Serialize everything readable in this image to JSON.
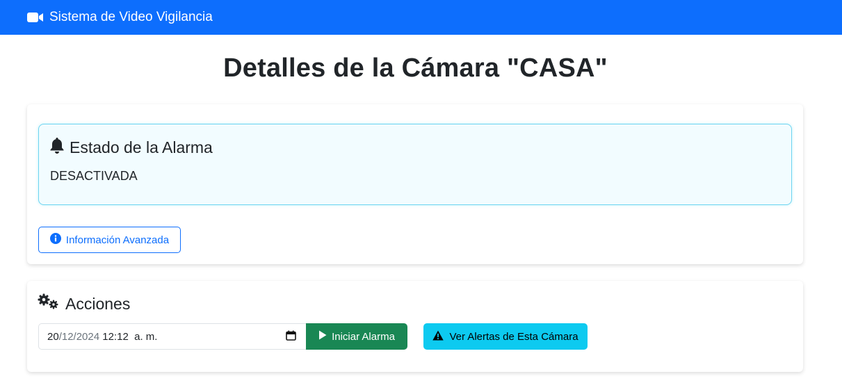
{
  "navbar": {
    "brand_label": "Sistema de Video Vigilancia",
    "brand_icon": "video-camera-icon",
    "background": "#0d6efd"
  },
  "page": {
    "title": "Detalles de la Cámara \"CASA\""
  },
  "alarm": {
    "heading": "Estado de la Alarma",
    "heading_icon": "bell-icon",
    "status": "DESACTIVADA",
    "advanced_button_label": "Información Avanzada",
    "advanced_button_icon": "info-circle-icon"
  },
  "actions": {
    "heading": "Acciones",
    "heading_icon": "gears-icon",
    "datetime": {
      "day": "20",
      "month_year": "/12/2024",
      "time": " 12:12  a. m.",
      "icon": "calendar-icon"
    },
    "start_button_label": "Iniciar Alarma",
    "start_button_icon": "play-icon",
    "start_button_color": "#198754",
    "alerts_button_label": "Ver Alertas de Esta Cámara",
    "alerts_button_icon": "warning-triangle-icon",
    "alerts_button_color": "#0dcaf0"
  }
}
